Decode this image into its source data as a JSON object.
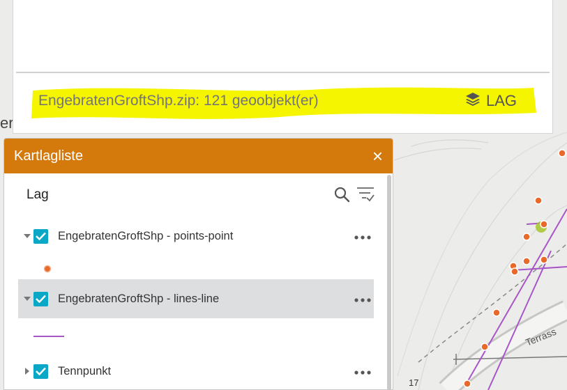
{
  "import_panel": {
    "status_text": "EngebratenGroftShp.zip: 121 geoobjekt(er)",
    "layers_link_label": "LAG",
    "layers_link_icon": "layers-icon",
    "highlight_color": "#f5f500"
  },
  "map": {
    "edge_text": "er",
    "street_label": "Terrass",
    "contour_label": "17"
  },
  "layer_panel": {
    "title": "Kartlagliste",
    "close_label": "×",
    "header_color": "#d4790b",
    "section_heading": "Lag",
    "search_icon": "search-icon",
    "filter_icon": "filter-list-icon",
    "layers": [
      {
        "name": "EngebratenGroftShp - points-point",
        "checked": true,
        "expanded": true,
        "selected": false,
        "legend": "orange-point",
        "more_label": "•••"
      },
      {
        "name": "EngebratenGroftShp - lines-line",
        "checked": true,
        "expanded": true,
        "selected": true,
        "legend": "purple-line",
        "more_label": "•••"
      },
      {
        "name": "Tennpunkt",
        "checked": true,
        "expanded": false,
        "selected": false,
        "more_label": "•••"
      }
    ],
    "checkbox_color": "#0aa7c6",
    "point_color": "#e8692a",
    "line_color": "#a855c8"
  }
}
